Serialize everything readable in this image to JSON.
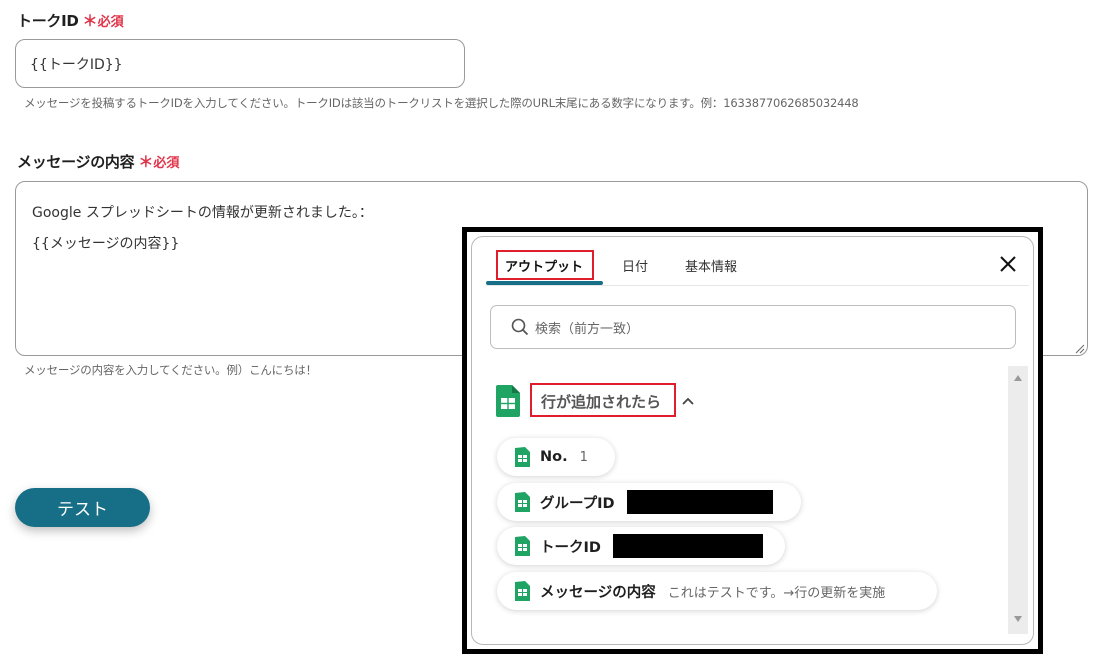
{
  "form": {
    "talk_id": {
      "label": "トークID",
      "required_mark": "＊",
      "required_text": "必須",
      "value": "{{トークID}}",
      "help": "メッセージを投稿するトークIDを入力してください。トークIDは該当のトークリストを選択した際のURL末尾にある数字になります。例：1633877062685032448"
    },
    "message": {
      "label": "メッセージの内容",
      "required_mark": "＊",
      "required_text": "必須",
      "value_line1": "Google スプレッドシートの情報が更新されました。：",
      "value_line2": "{{メッセージの内容}}",
      "help": "メッセージの内容を入力してください。例）こんにちは！"
    },
    "test_button": "テスト"
  },
  "popup": {
    "tabs": [
      {
        "label": "アウトプット",
        "active": true
      },
      {
        "label": "日付",
        "active": false
      },
      {
        "label": "基本情報",
        "active": false
      }
    ],
    "close_icon": "close-icon",
    "search_placeholder": "検索（前方一致）",
    "group": {
      "title": "行が追加されたら",
      "expanded": true,
      "items": [
        {
          "name": "No.",
          "value": "1",
          "redacted": false
        },
        {
          "name": "グループID",
          "value": "",
          "redacted": true
        },
        {
          "name": "トークID",
          "value": "",
          "redacted": true
        },
        {
          "name": "メッセージの内容",
          "value": "これはテストです。→行の更新を実施",
          "redacted": false
        }
      ]
    }
  },
  "colors": {
    "accent": "#176f87",
    "required": "#e0344a",
    "highlight": "#e01e2b",
    "sheets_green": "#1fa463"
  }
}
